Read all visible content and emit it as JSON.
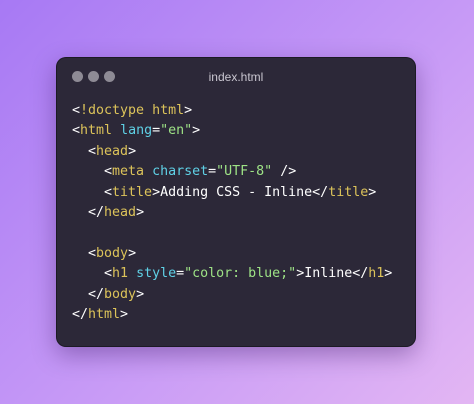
{
  "window": {
    "title": "index.html"
  },
  "code": {
    "lines": [
      [
        {
          "k": "text",
          "v": "<"
        },
        {
          "k": "tag",
          "v": "!doctype html"
        },
        {
          "k": "text",
          "v": ">"
        }
      ],
      [
        {
          "k": "text",
          "v": "<"
        },
        {
          "k": "tag",
          "v": "html"
        },
        {
          "k": "text",
          "v": " "
        },
        {
          "k": "attr",
          "v": "lang"
        },
        {
          "k": "text",
          "v": "="
        },
        {
          "k": "str",
          "v": "\"en\""
        },
        {
          "k": "text",
          "v": ">"
        }
      ],
      [
        {
          "k": "text",
          "v": "  <"
        },
        {
          "k": "tag",
          "v": "head"
        },
        {
          "k": "text",
          "v": ">"
        }
      ],
      [
        {
          "k": "text",
          "v": "    <"
        },
        {
          "k": "tag",
          "v": "meta"
        },
        {
          "k": "text",
          "v": " "
        },
        {
          "k": "attr",
          "v": "charset"
        },
        {
          "k": "text",
          "v": "="
        },
        {
          "k": "str",
          "v": "\"UTF-8\""
        },
        {
          "k": "text",
          "v": " />"
        }
      ],
      [
        {
          "k": "text",
          "v": "    <"
        },
        {
          "k": "tag",
          "v": "title"
        },
        {
          "k": "text",
          "v": ">Adding CSS - Inline</"
        },
        {
          "k": "tag",
          "v": "title"
        },
        {
          "k": "text",
          "v": ">"
        }
      ],
      [
        {
          "k": "text",
          "v": "  </"
        },
        {
          "k": "tag",
          "v": "head"
        },
        {
          "k": "text",
          "v": ">"
        }
      ],
      [],
      [
        {
          "k": "text",
          "v": "  <"
        },
        {
          "k": "tag",
          "v": "body"
        },
        {
          "k": "text",
          "v": ">"
        }
      ],
      [
        {
          "k": "text",
          "v": "    <"
        },
        {
          "k": "tag",
          "v": "h1"
        },
        {
          "k": "text",
          "v": " "
        },
        {
          "k": "attr",
          "v": "style"
        },
        {
          "k": "text",
          "v": "="
        },
        {
          "k": "str",
          "v": "\"color: blue;\""
        },
        {
          "k": "text",
          "v": ">Inline</"
        },
        {
          "k": "tag",
          "v": "h1"
        },
        {
          "k": "text",
          "v": ">"
        }
      ],
      [
        {
          "k": "text",
          "v": "  </"
        },
        {
          "k": "tag",
          "v": "body"
        },
        {
          "k": "text",
          "v": ">"
        }
      ],
      [
        {
          "k": "text",
          "v": "</"
        },
        {
          "k": "tag",
          "v": "html"
        },
        {
          "k": "text",
          "v": ">"
        }
      ]
    ]
  },
  "colors": {
    "tag": "#dcc35a",
    "attr": "#5fd1e6",
    "string": "#9ee386",
    "text": "#ffffff",
    "window_bg": "#2c2838",
    "window_dot": "#8e8b95"
  }
}
